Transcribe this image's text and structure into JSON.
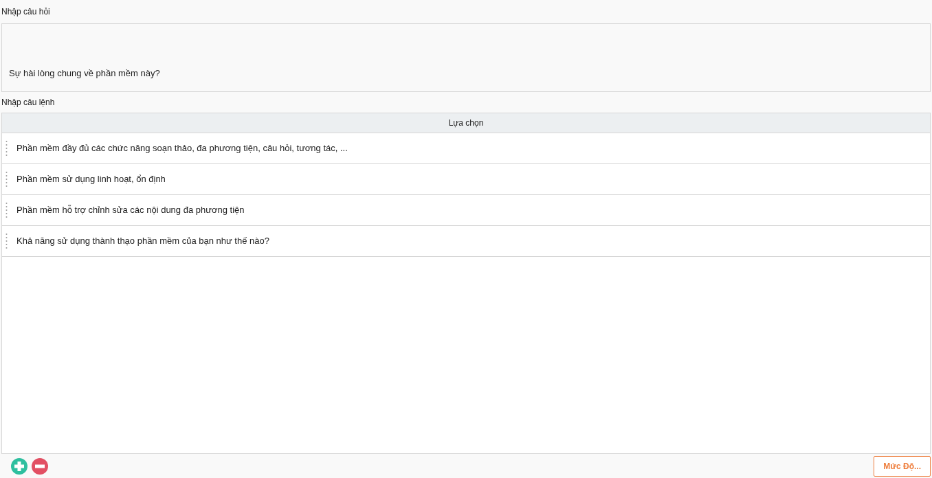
{
  "question": {
    "label": "Nhập câu hỏi",
    "value": "Sự hài lòng chung về phần mềm này?"
  },
  "statements": {
    "label": "Nhập câu lệnh",
    "column": "Lựa chọn",
    "rows": [
      {
        "text": "Phần mềm đầy đủ các chức năng soạn thảo, đa phương tiện, câu hỏi, tương tác, ..."
      },
      {
        "text": "Phần mềm sử dụng linh hoạt, ổn định"
      },
      {
        "text": "Phần mềm hỗ trợ chỉnh sửa các nội dung đa phương tiện"
      },
      {
        "text": "Khả năng sử dụng thành thạo phần mềm của bạn như thế nào?"
      }
    ]
  },
  "level_button": "Mức Độ..."
}
